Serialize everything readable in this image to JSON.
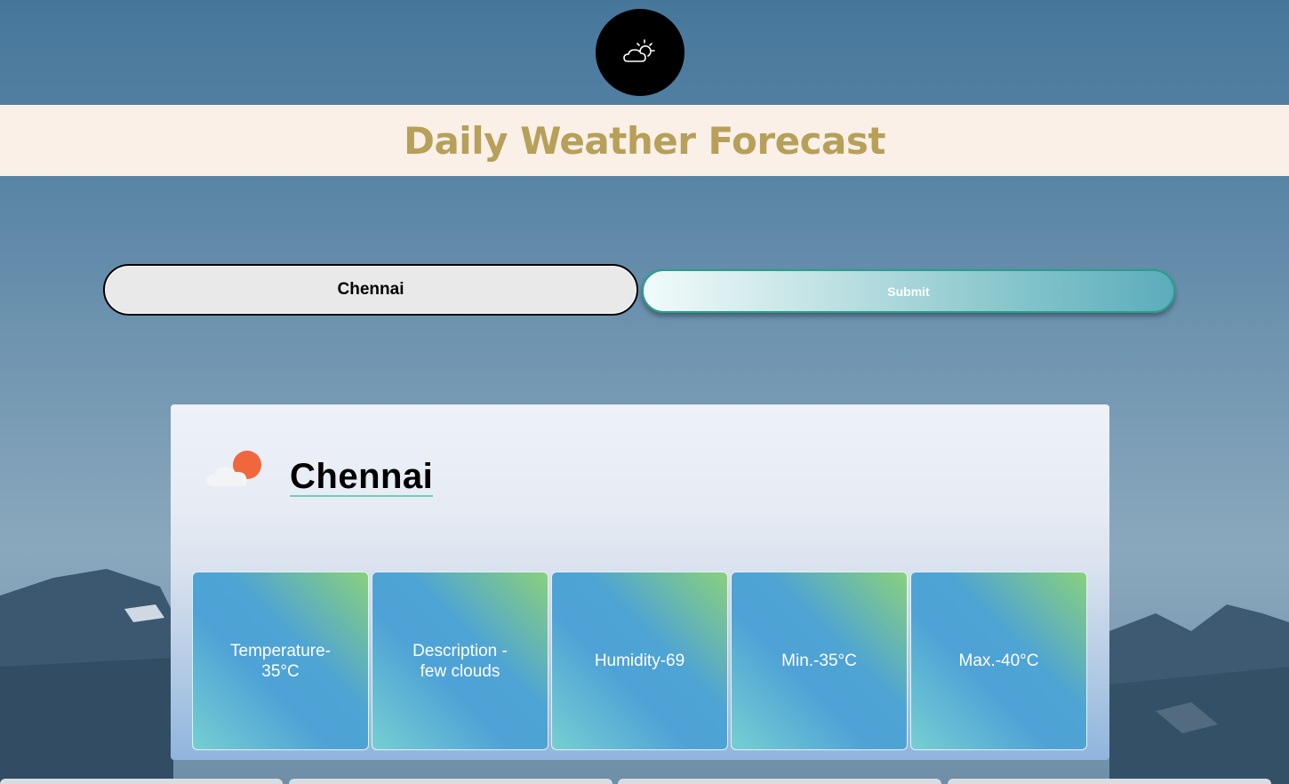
{
  "app": {
    "title": "Daily Weather Forecast",
    "logo_icon": "cloud-sun-icon"
  },
  "search": {
    "value": "Chennai",
    "submit_label": "Submit"
  },
  "result": {
    "city": "Chennai",
    "icon": "partly-cloudy-icon",
    "tiles": [
      {
        "label": "Temperature-35°C"
      },
      {
        "label": "Description - few clouds"
      },
      {
        "label": "Humidity-69"
      },
      {
        "label": "Min.-35°C"
      },
      {
        "label": "Max.-40°C"
      }
    ]
  },
  "colors": {
    "title": "#b6a05a",
    "title_bar": "#fbf0e7",
    "button_border": "#23a28a",
    "sun": "#f0673e"
  }
}
